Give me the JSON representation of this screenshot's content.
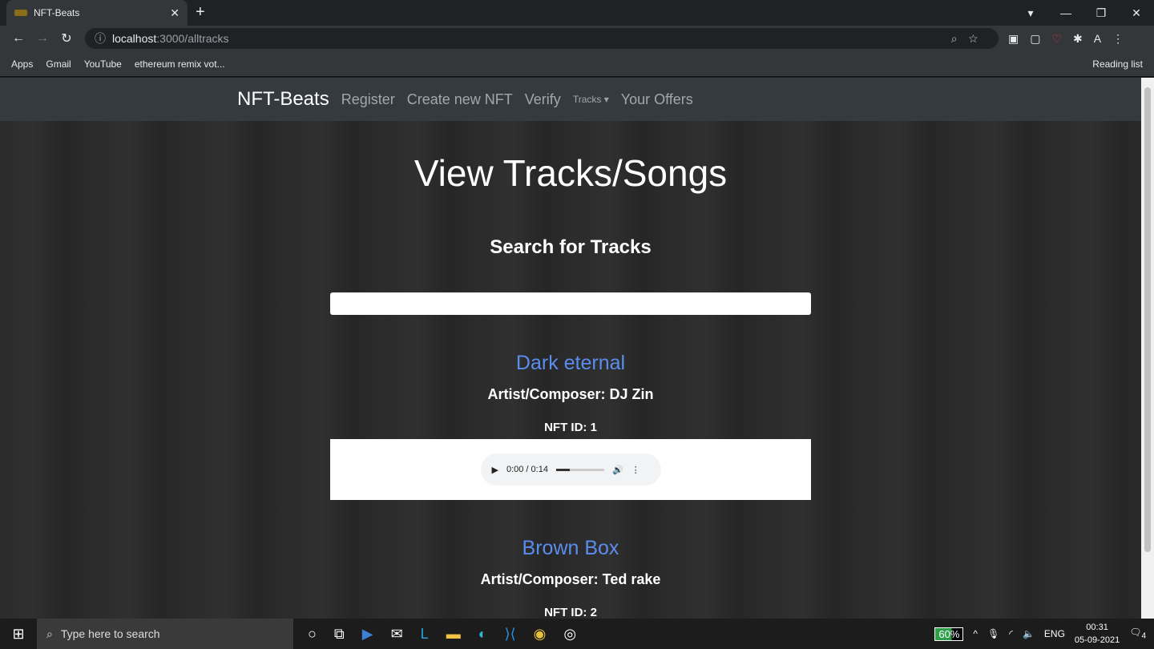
{
  "browser": {
    "tab_title": "NFT-Beats",
    "url_host": "localhost",
    "url_path": ":3000/alltracks",
    "bookmarks": [
      "Apps",
      "Gmail",
      "YouTube",
      "ethereum remix vot..."
    ],
    "reading_list": "Reading list",
    "profile": "A"
  },
  "navbar": {
    "brand": "NFT-Beats",
    "links": [
      "Register",
      "Create new NFT",
      "Verify",
      "Tracks",
      "Your Offers"
    ]
  },
  "main": {
    "title": "View Tracks/Songs",
    "search_heading": "Search for Tracks",
    "search_value": "",
    "tracks": [
      {
        "title": "Dark eternal",
        "artist": "Artist/Composer: DJ Zin",
        "nft_id": "NFT ID: 1",
        "time": "0:00 / 0:14",
        "progress": 0.28
      },
      {
        "title": "Brown Box",
        "artist": "Artist/Composer: Ted rake",
        "nft_id": "NFT ID: 2"
      }
    ]
  },
  "taskbar": {
    "search_placeholder": "Type here to search",
    "battery": "60%",
    "lang": "ENG",
    "time": "00:31",
    "date": "05-09-2021",
    "notifications": "4"
  }
}
